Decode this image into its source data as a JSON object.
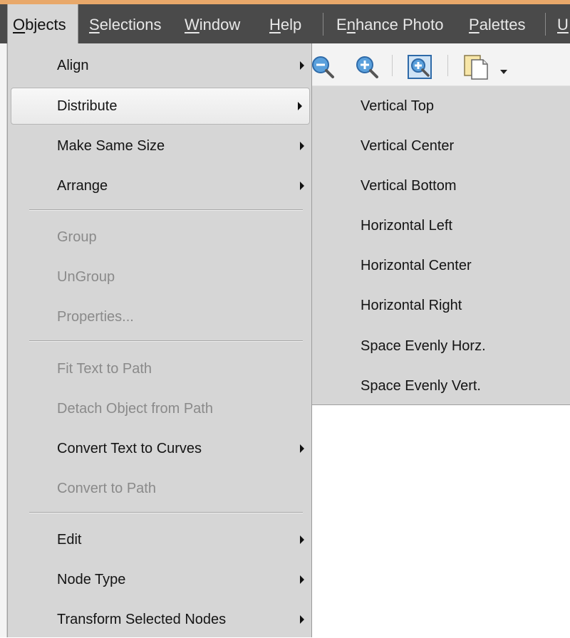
{
  "menubar": {
    "items": [
      {
        "label": "Objects",
        "mnemonic": "O",
        "rest": "bjects"
      },
      {
        "label": "Selections",
        "mnemonic": "S",
        "rest": "elections"
      },
      {
        "label": "Window",
        "mnemonic": "W",
        "rest": "indow"
      },
      {
        "label": "Help",
        "mnemonic": "H",
        "rest": "elp"
      },
      {
        "label": "Enhance Photo",
        "pre": "E",
        "mnemonic": "n",
        "rest": "hance Photo"
      },
      {
        "label": "Palettes",
        "mnemonic": "P",
        "rest": "alettes"
      },
      {
        "label": "U",
        "mnemonic": "U",
        "rest": ""
      }
    ]
  },
  "objects_menu": {
    "items": [
      {
        "label": "Align",
        "enabled": true,
        "submenu": true
      },
      {
        "label": "Distribute",
        "enabled": true,
        "submenu": true,
        "highlighted": true
      },
      {
        "label": "Make Same Size",
        "enabled": true,
        "submenu": true
      },
      {
        "label": "Arrange",
        "enabled": true,
        "submenu": true
      },
      {
        "label": "Group",
        "enabled": false,
        "submenu": false
      },
      {
        "label": "UnGroup",
        "enabled": false,
        "submenu": false
      },
      {
        "label": "Properties...",
        "enabled": false,
        "submenu": false
      },
      {
        "label": "Fit Text to Path",
        "enabled": false,
        "submenu": false
      },
      {
        "label": "Detach Object from Path",
        "enabled": false,
        "submenu": false
      },
      {
        "label": "Convert Text to Curves",
        "enabled": true,
        "submenu": true
      },
      {
        "label": "Convert to Path",
        "enabled": false,
        "submenu": false
      },
      {
        "label": "Edit",
        "enabled": true,
        "submenu": true
      },
      {
        "label": "Node Type",
        "enabled": true,
        "submenu": true
      },
      {
        "label": "Transform Selected Nodes",
        "enabled": true,
        "submenu": true
      }
    ]
  },
  "distribute_submenu": {
    "items": [
      "Vertical Top",
      "Vertical Center",
      "Vertical Bottom",
      "Horizontal Left",
      "Horizontal Center",
      "Horizontal Right",
      "Space Evenly Horz.",
      "Space Evenly Vert."
    ]
  },
  "toolbar": {
    "icons": [
      "zoom-out-icon",
      "zoom-in-icon",
      "zoom-to-fit-icon",
      "new-document-icon",
      "dropdown-arrow-icon"
    ]
  },
  "colors": {
    "menubar_bg": "#4a4a4a",
    "menu_bg": "#d6d6d6",
    "accent_strip": "#e8a86a"
  }
}
